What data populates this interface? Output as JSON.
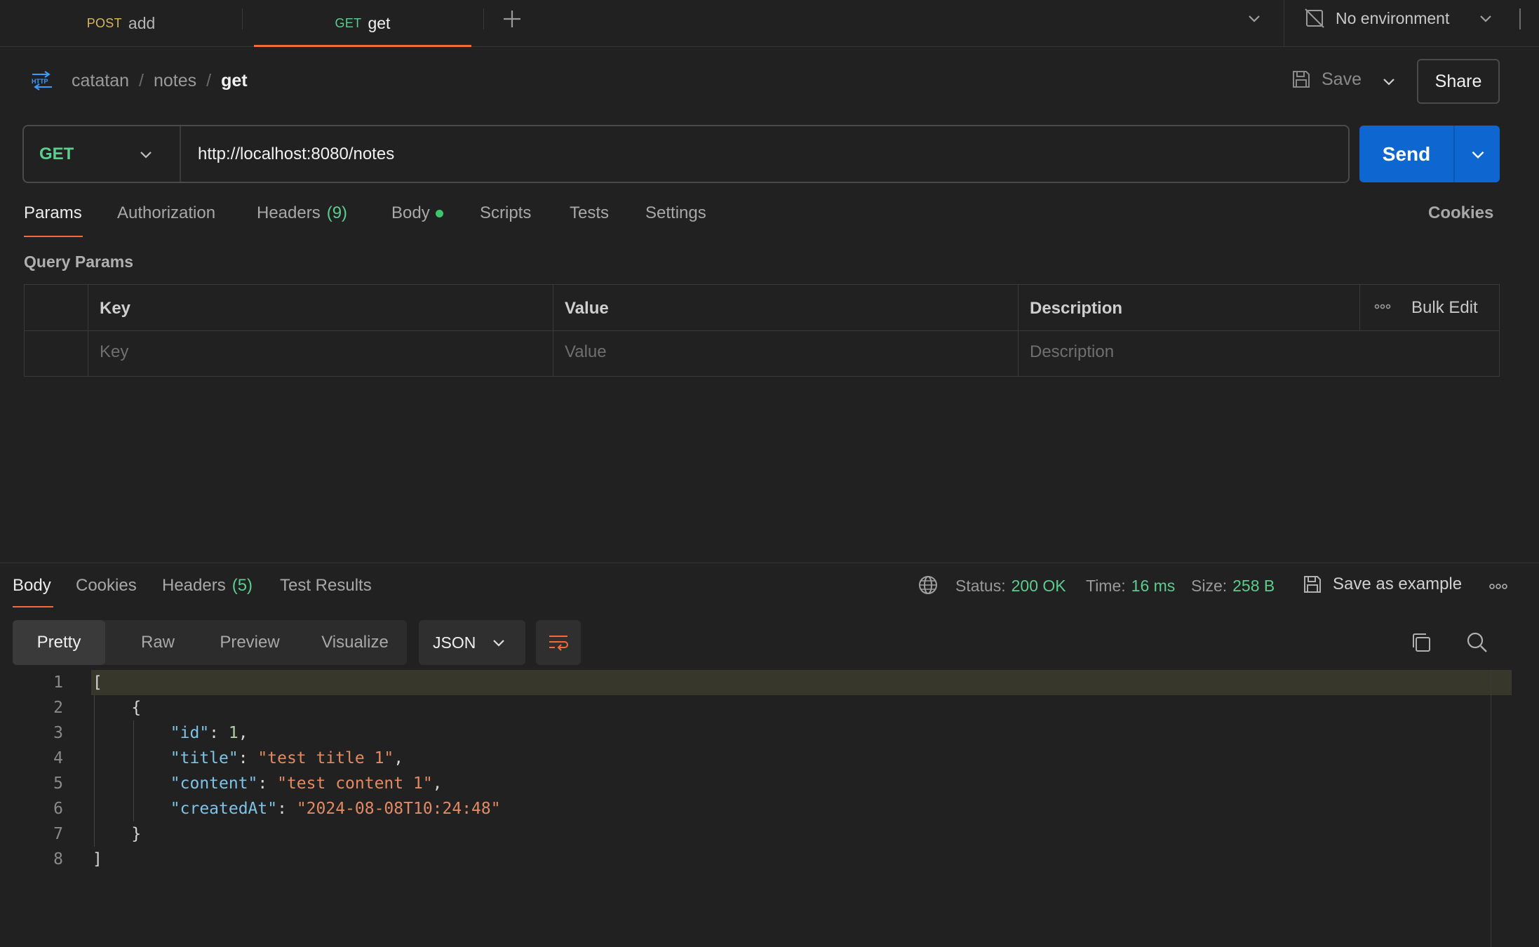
{
  "tabs": [
    {
      "method": "POST",
      "name": "add",
      "method_color": "#d9b560"
    },
    {
      "method": "GET",
      "name": "get",
      "method_color": "#5ccc8f"
    }
  ],
  "environment": {
    "label": "No environment"
  },
  "breadcrumb": {
    "workspace": "catatan",
    "folder": "notes",
    "request": "get"
  },
  "header_actions": {
    "save": "Save",
    "share": "Share"
  },
  "request": {
    "method": "GET",
    "url": "http://localhost:8080/notes",
    "send": "Send"
  },
  "request_tabs": {
    "params": "Params",
    "authorization": "Authorization",
    "headers": "Headers",
    "headers_count": "(9)",
    "body": "Body",
    "scripts": "Scripts",
    "tests": "Tests",
    "settings": "Settings",
    "cookies": "Cookies"
  },
  "query_params": {
    "title": "Query Params",
    "columns": [
      "Key",
      "Value",
      "Description"
    ],
    "bulk_edit": "Bulk Edit",
    "placeholders": {
      "key": "Key",
      "value": "Value",
      "description": "Description"
    }
  },
  "response": {
    "tabs": {
      "body": "Body",
      "cookies": "Cookies",
      "headers": "Headers",
      "headers_count": "(5)",
      "test_results": "Test Results"
    },
    "status_label": "Status:",
    "status": "200 OK",
    "time_label": "Time:",
    "time": "16 ms",
    "size_label": "Size:",
    "size": "258 B",
    "save_example": "Save as example",
    "views": [
      "Pretty",
      "Raw",
      "Preview",
      "Visualize"
    ],
    "format": "JSON",
    "line_numbers": [
      "1",
      "2",
      "3",
      "4",
      "5",
      "6",
      "7",
      "8"
    ],
    "body": {
      "open_bracket": "[",
      "open_brace": "{",
      "k1": "\"id\"",
      "v1": "1",
      "k2": "\"title\"",
      "v2": "\"test title 1\"",
      "k3": "\"content\"",
      "v3": "\"test content 1\"",
      "k4": "\"createdAt\"",
      "v4": "\"2024-08-08T10:24:48\"",
      "close_brace": "}",
      "close_bracket": "]"
    }
  },
  "colors": {
    "accent": "#f26b3a",
    "send": "#0e66d0",
    "success": "#5ccc8f",
    "link": "#3d9bff"
  }
}
